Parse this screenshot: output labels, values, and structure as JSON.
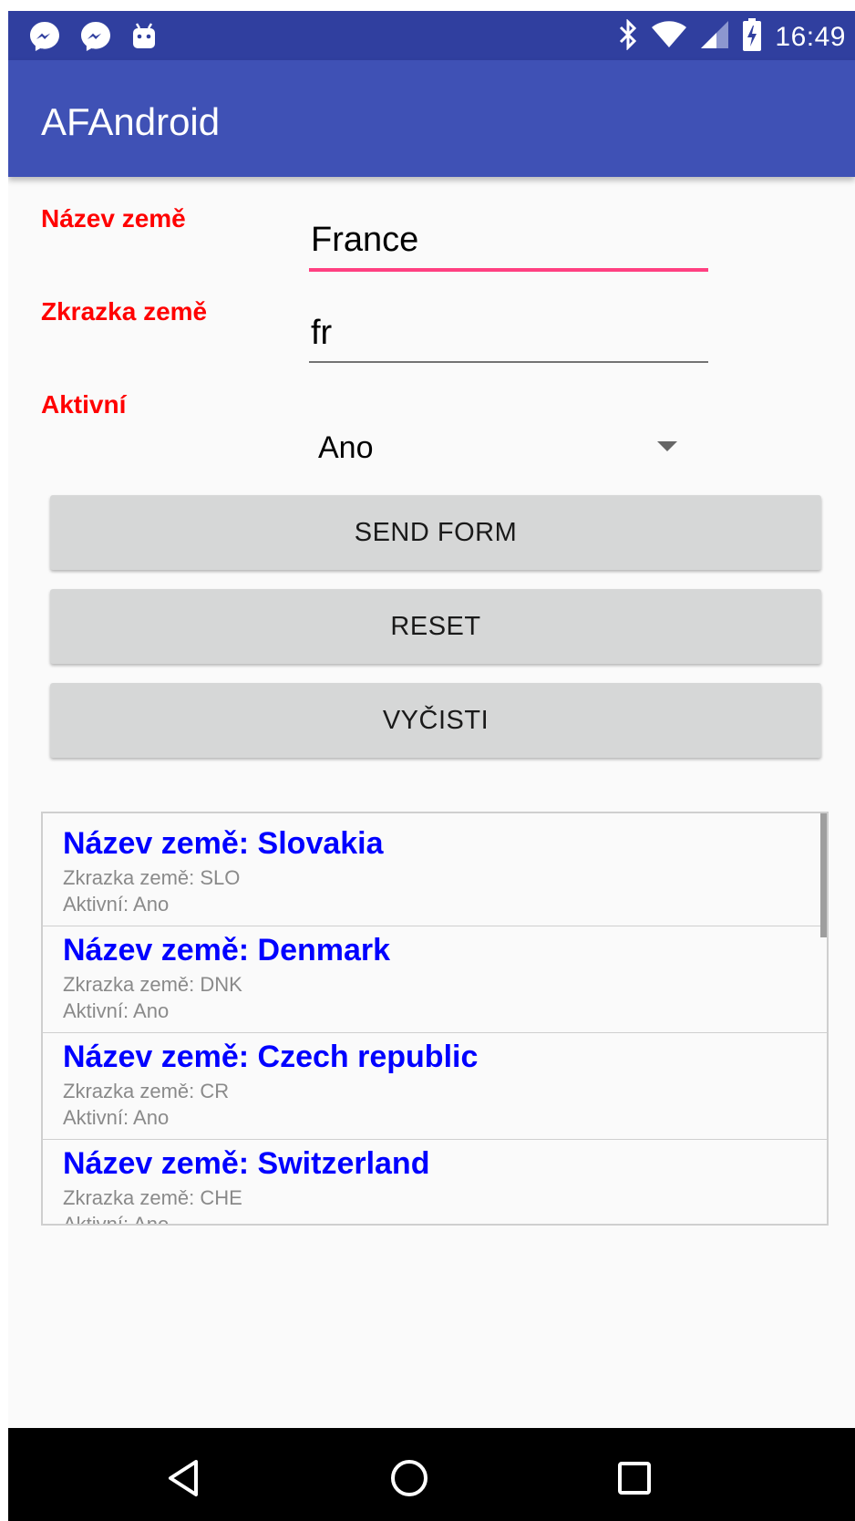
{
  "status_bar": {
    "time": "16:49",
    "left_icons": [
      "messenger-icon",
      "messenger-icon",
      "android-debug-icon"
    ],
    "right_icons": [
      "bluetooth-icon",
      "wifi-icon",
      "cell-signal-icon",
      "battery-charging-icon"
    ]
  },
  "app_bar": {
    "title": "AFAndroid"
  },
  "form": {
    "name_label": "Název země",
    "name_value": "France",
    "code_label": "Zkrazka země",
    "code_value": "fr",
    "active_label": "Aktivní",
    "active_selected": "Ano"
  },
  "buttons": {
    "send": "SEND FORM",
    "reset": "RESET",
    "clear": "VYČISTI"
  },
  "list": {
    "items": [
      {
        "title": "Název země: Slovakia",
        "code": "Zkrazka země: SLO",
        "active": "Aktivní: Ano"
      },
      {
        "title": "Název země: Denmark",
        "code": "Zkrazka země: DNK",
        "active": "Aktivní: Ano"
      },
      {
        "title": "Název země: Czech republic",
        "code": "Zkrazka země: CR",
        "active": "Aktivní: Ano"
      },
      {
        "title": "Název země: Switzerland",
        "code": "Zkrazka země: CHE",
        "active": "Aktivní: Ano"
      }
    ]
  },
  "nav_bar": {
    "icons": [
      "back-icon",
      "home-icon",
      "recents-icon"
    ]
  },
  "colors": {
    "status_bar": "#303f9f",
    "app_bar": "#3f51b5",
    "label_red": "#ff0000",
    "accent": "#ff4081",
    "list_title_blue": "#0000ff"
  }
}
